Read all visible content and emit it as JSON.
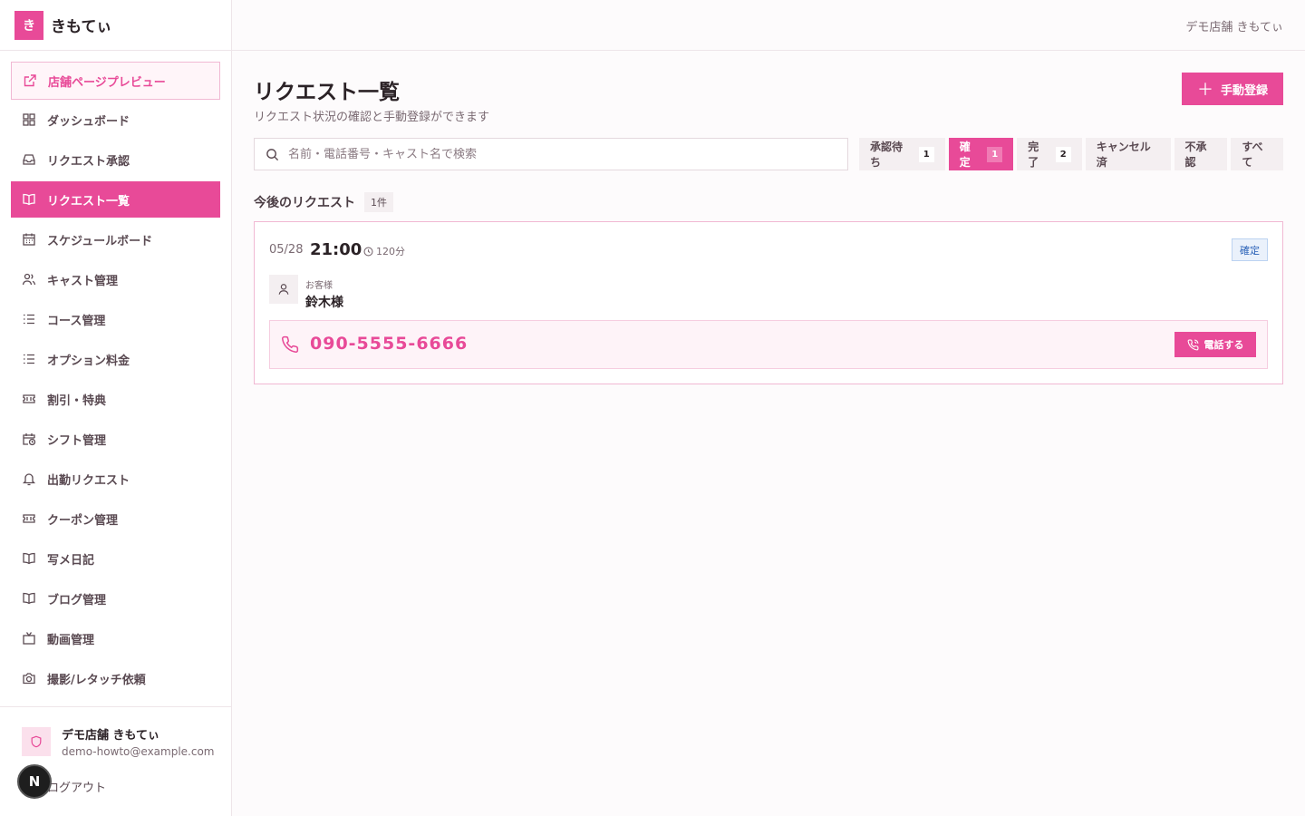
{
  "brand": {
    "logo_char": "き",
    "name": "きもてぃ"
  },
  "colors": {
    "accent": "#e84a98",
    "confirmed_badge": "#2c63b8"
  },
  "sidebar": {
    "preview_label": "店舗ページプレビュー",
    "items": [
      {
        "label": "ダッシュボード",
        "icon": "dashboard-icon"
      },
      {
        "label": "リクエスト承認",
        "icon": "inbox-icon"
      },
      {
        "label": "リクエスト一覧",
        "icon": "book-icon",
        "active": true
      },
      {
        "label": "スケジュールボード",
        "icon": "calendar-icon"
      },
      {
        "label": "キャスト管理",
        "icon": "users-icon"
      },
      {
        "label": "コース管理",
        "icon": "list-icon"
      },
      {
        "label": "オプション料金",
        "icon": "list-icon"
      },
      {
        "label": "割引・特典",
        "icon": "ticket-icon"
      },
      {
        "label": "シフト管理",
        "icon": "calendar-clock-icon"
      },
      {
        "label": "出勤リクエスト",
        "icon": "bell-icon"
      },
      {
        "label": "クーポン管理",
        "icon": "ticket-icon"
      },
      {
        "label": "写メ日記",
        "icon": "book-icon"
      },
      {
        "label": "ブログ管理",
        "icon": "book-icon"
      },
      {
        "label": "動画管理",
        "icon": "tv-icon"
      },
      {
        "label": "撮影/レタッチ依頼",
        "icon": "camera-icon"
      }
    ],
    "footer": {
      "store_name": "デモ店舗 きもてぃ",
      "email": "demo-howto@example.com",
      "logout": "ログアウト"
    },
    "n_badge": "N"
  },
  "header": {
    "store_name": "デモ店舗 きもてぃ"
  },
  "main": {
    "title": "リクエスト一覧",
    "subtitle": "リクエスト状況の確認と手動登録ができます",
    "add_button": "手動登録",
    "search_placeholder": "名前・電話番号・キャスト名で検索",
    "filters": [
      {
        "label": "承認待ち",
        "count": "1"
      },
      {
        "label": "確定",
        "count": "1",
        "active": true
      },
      {
        "label": "完了",
        "count": "2"
      },
      {
        "label": "キャンセル済",
        "count": ""
      },
      {
        "label": "不承認",
        "count": ""
      },
      {
        "label": "すべて",
        "count": ""
      }
    ],
    "section_title": "今後のリクエスト",
    "section_count": "1件",
    "request": {
      "date": "05/28",
      "time": "21:00",
      "duration": "120分",
      "status": "確定",
      "customer_label": "お客様",
      "customer_name": "鈴木様",
      "phone": "090-5555-6666",
      "call_button": "電話する"
    }
  }
}
